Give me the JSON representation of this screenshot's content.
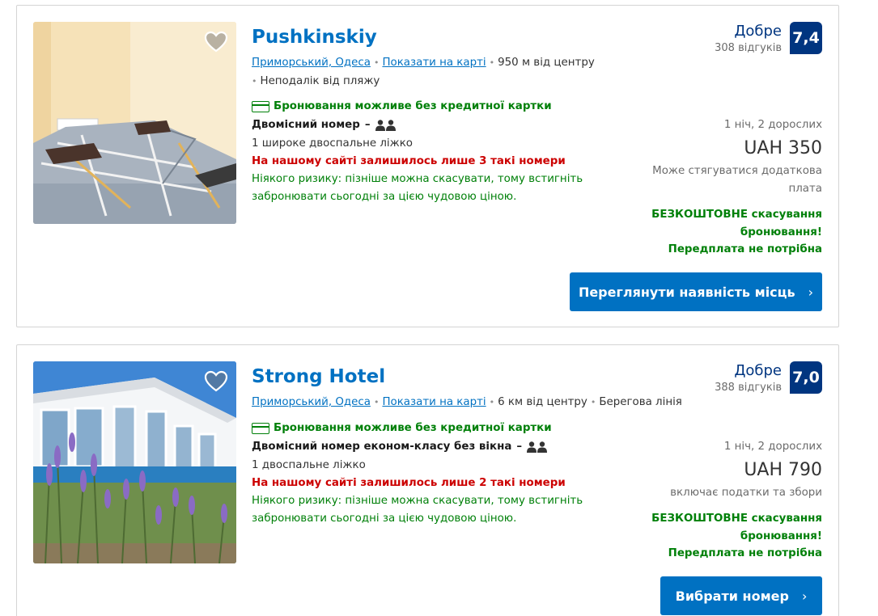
{
  "listings": [
    {
      "name": "Pushkinskiy",
      "location": "Приморський, Одеса",
      "show_on_map": "Показати на карті",
      "distance": "950 м від центру",
      "extra_tag": "",
      "nearby": "Неподалік від пляжу",
      "no_card": "Бронювання можливе без кредитної картки",
      "room_type": "Двомісний номер",
      "bed": "1 широке двоспальне ліжко",
      "rooms_left": "На нашому сайті залишилось лише 3 такі номери",
      "risk_free": "Ніякого ризику: пізніше можна скасувати, тому встигніть забронювати сьогодні за цією чудовою ціною.",
      "verdict": "Добре",
      "reviews": "308 відгуків",
      "score": "7,4",
      "guests": "1 ніч, 2 дорослих",
      "price": "UAH 350",
      "price_note": "Може стягуватися додаткова плата",
      "free_cancel": "БЕЗКОШТОВНЕ скасування бронювання!",
      "no_prepay": "Передплата не потрібна",
      "cta": "Переглянути наявність місць"
    },
    {
      "name": "Strong Hotel",
      "location": "Приморський, Одеса",
      "show_on_map": "Показати на карті",
      "distance": "6 км від центру",
      "extra_tag": "Берегова лінія",
      "nearby": "",
      "no_card": "Бронювання можливе без кредитної картки",
      "room_type": "Двомісний номер економ-класу без вікна",
      "bed": "1 двоспальне ліжко",
      "rooms_left": "На нашому сайті залишилось лише 2 такі номери",
      "risk_free": "Ніякого ризику: пізніше можна скасувати, тому встигніть забронювати сьогодні за цією чудовою ціною.",
      "verdict": "Добре",
      "reviews": "388 відгуків",
      "score": "7,0",
      "guests": "1 ніч, 2 дорослих",
      "price": "UAH 790",
      "price_note": "включає податки та збори",
      "free_cancel": "БЕЗКОШТОВНЕ скасування бронювання!",
      "no_prepay": "Передплата не потрібна",
      "cta": "Вибрати номер"
    }
  ],
  "icons": {
    "favorite": "heart-icon",
    "credit_card": "credit-card-icon",
    "occupancy": "two-persons-icon",
    "chevron": "chevron-right-icon"
  },
  "colors": {
    "brand_blue": "#0071c2",
    "dark_blue": "#003580",
    "green": "#008009",
    "red": "#cc0000"
  }
}
